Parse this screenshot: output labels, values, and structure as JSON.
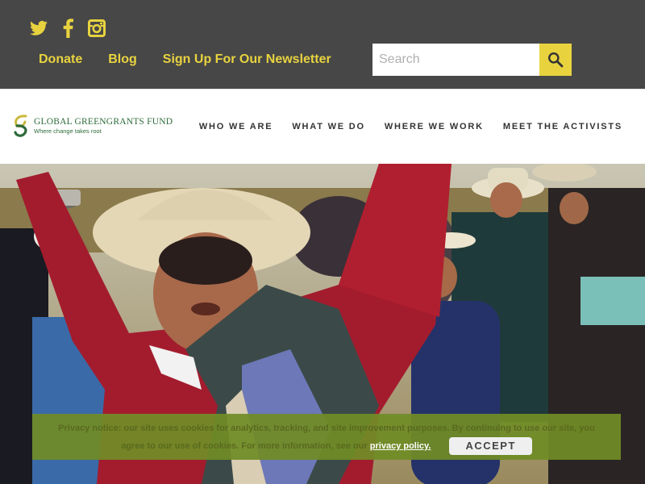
{
  "social": [
    {
      "name": "twitter-icon"
    },
    {
      "name": "facebook-icon"
    },
    {
      "name": "instagram-icon"
    }
  ],
  "top_links": {
    "donate": "Donate",
    "blog": "Blog",
    "newsletter": "Sign Up For Our Newsletter"
  },
  "search": {
    "placeholder": "Search",
    "value": "",
    "button_icon": "search-icon"
  },
  "logo": {
    "name": "GLOBAL GREENGRANTS FUND",
    "tagline": "Where change takes root"
  },
  "nav": {
    "who": "WHO WE ARE",
    "what": "WHAT WE DO",
    "where": "WHERE WE WORK",
    "activists": "MEET THE ACTIVISTS"
  },
  "cookie": {
    "text": "Privacy notice: our site uses cookies for analytics, tracking, and site improvement purposes. By continuing to use our site, you agree to our use of cookies. For more information, see our",
    "link": "privacy policy.",
    "accept": "ACCEPT"
  },
  "colors": {
    "topbar_bg": "#474747",
    "accent_yellow": "#e8d33f",
    "brand_green": "#2e6b3a",
    "cookie_bg": "#708c26"
  }
}
